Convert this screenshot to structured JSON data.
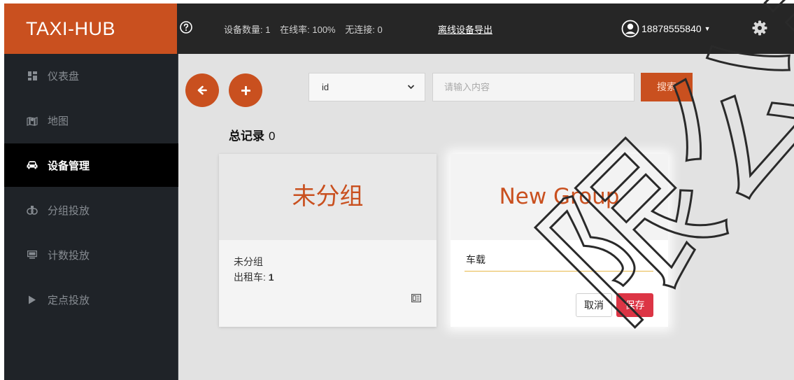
{
  "app": {
    "brand": "TAXI-HUB"
  },
  "header": {
    "stats": [
      {
        "label": "设备数量:",
        "value": "1"
      },
      {
        "label": "在线率:",
        "value": "100%"
      },
      {
        "label": "无连接:",
        "value": "0"
      }
    ],
    "export_link": "离线设备导出",
    "user_phone": "18878555840",
    "icons": {
      "help": "help-circle-icon",
      "user": "user-circle-icon",
      "settings": "gear-icon"
    }
  },
  "sidebar": {
    "items": [
      {
        "label": "仪表盘",
        "icon": "dashboard-icon",
        "active": false
      },
      {
        "label": "地图",
        "icon": "map-pin-icon",
        "active": false
      },
      {
        "label": "设备管理",
        "icon": "car-icon",
        "active": true
      },
      {
        "label": "分组投放",
        "icon": "group-icon",
        "active": false
      },
      {
        "label": "计数投放",
        "icon": "counter-icon",
        "active": false
      },
      {
        "label": "定点投放",
        "icon": "play-icon",
        "active": false
      }
    ]
  },
  "toolbar": {
    "select_value": "id",
    "search_placeholder": "请输入内容",
    "search_button": "搜索"
  },
  "summary": {
    "label": "总记录",
    "count": "0"
  },
  "groups": [
    {
      "title": "未分组",
      "name": "未分组",
      "count_label": "出租车:",
      "count": "1"
    }
  ],
  "new_group": {
    "title": "New Group",
    "input_value": "车载",
    "cancel_label": "取消",
    "save_label": "保存"
  },
  "colors": {
    "brand": "#c9501f",
    "topbar": "#262626",
    "sidebar": "#1f2328",
    "save": "#dc3545",
    "input_underline": "#e8b84a"
  },
  "watermark_text": "限公司"
}
